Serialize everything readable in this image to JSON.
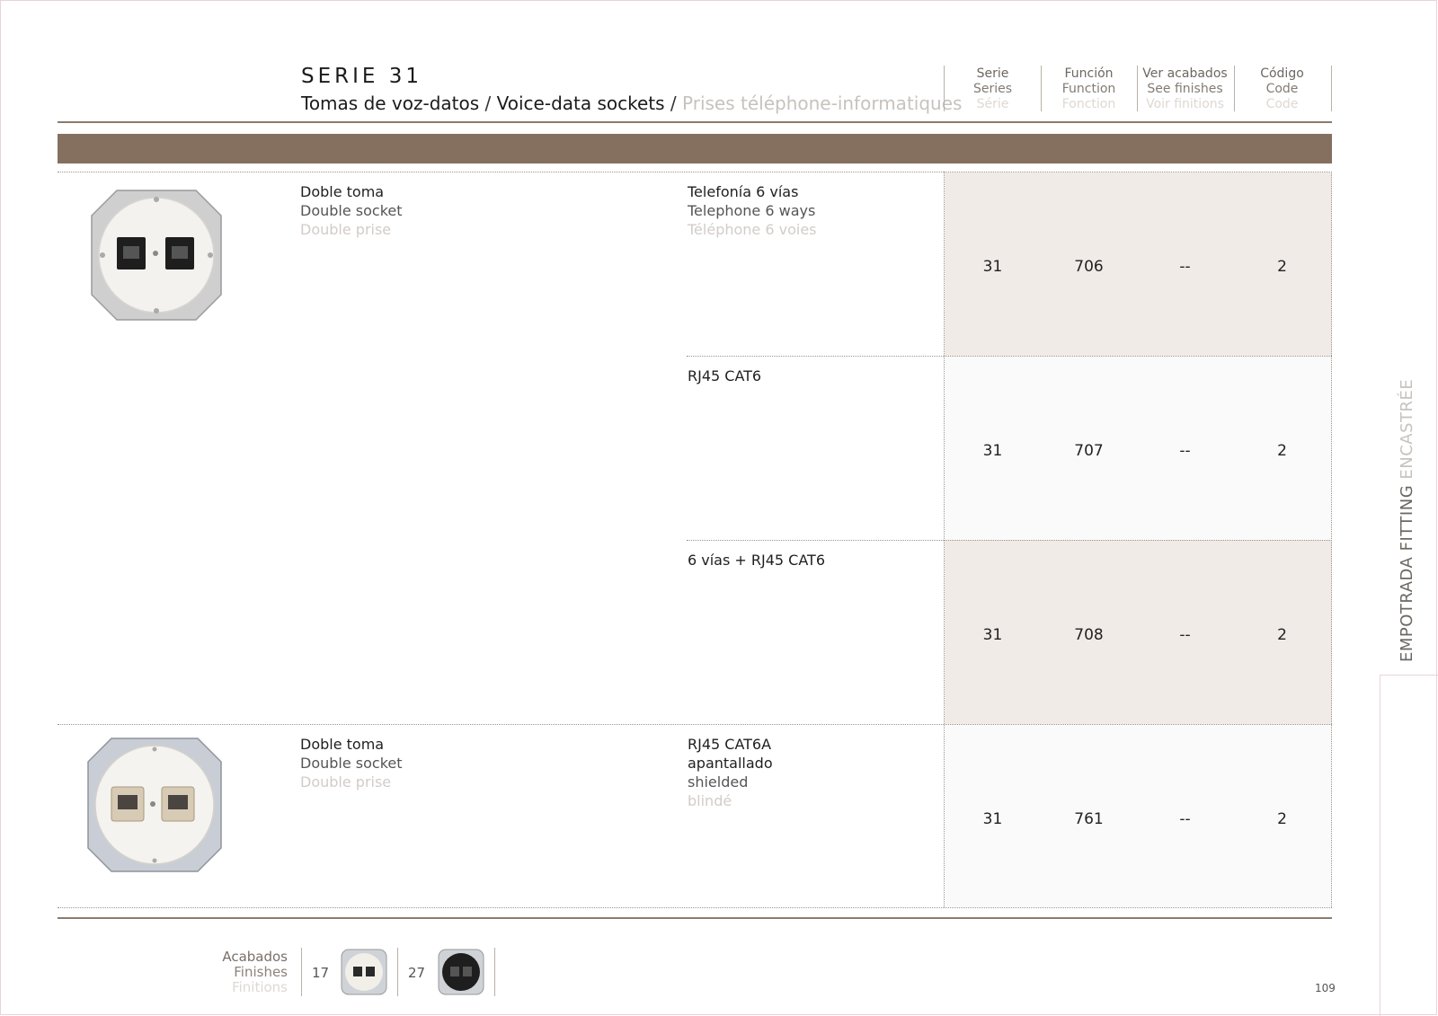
{
  "header": {
    "serie_title": "SERIE 31",
    "subtitle_es": "Tomas de voz-datos",
    "subtitle_sep1": " / ",
    "subtitle_en": "Voice-data sockets",
    "subtitle_sep2": " / ",
    "subtitle_fr": "Prises téléphone-informatiques",
    "columns": [
      {
        "es": "Serie",
        "en": "Series",
        "fr": "Série"
      },
      {
        "es": "Función",
        "en": "Function",
        "fr": "Fonction"
      },
      {
        "es": "Ver acabados",
        "en": "See finishes",
        "fr": "Voir finitions"
      },
      {
        "es": "Código",
        "en": "Code",
        "fr": "Code"
      }
    ]
  },
  "products": [
    {
      "name_es": "Doble toma",
      "name_en": "Double socket",
      "name_fr": "Double prise"
    },
    {
      "name_es": "Doble toma",
      "name_en": "Double socket",
      "name_fr": "Double prise"
    }
  ],
  "rows": [
    {
      "func_1": "Telefonía 6 vías",
      "func_2": "Telephone 6 ways",
      "func_3": "Téléphone 6 voies",
      "func_4": "",
      "serie": "31",
      "funcion": "706",
      "acabados": "--",
      "codigo": "2"
    },
    {
      "func_1": "RJ45 CAT6",
      "func_2": "",
      "func_3": "",
      "func_4": "",
      "serie": "31",
      "funcion": "707",
      "acabados": "--",
      "codigo": "2"
    },
    {
      "func_1": "6 vías + RJ45 CAT6",
      "func_2": "",
      "func_3": "",
      "func_4": "",
      "serie": "31",
      "funcion": "708",
      "acabados": "--",
      "codigo": "2"
    },
    {
      "func_1": "RJ45 CAT6A",
      "func_2": "apantallado",
      "func_3": "shielded",
      "func_4": "blindé",
      "serie": "31",
      "funcion": "761",
      "acabados": "--",
      "codigo": "2"
    }
  ],
  "finishes": {
    "label_es": "Acabados",
    "label_en": "Finishes",
    "label_fr": "Finitions",
    "items": [
      {
        "code": "17",
        "color": "#f2efe9"
      },
      {
        "code": "27",
        "color": "#1e1e1e"
      }
    ]
  },
  "side_tab": {
    "part1": "EMPOTRADA FITTING ",
    "part2": "ENCASTRÉE"
  },
  "page_number": "109",
  "colors": {
    "band": "#85705f",
    "shade": "#f0ebe6",
    "accent_line": "#8a7b6e"
  }
}
